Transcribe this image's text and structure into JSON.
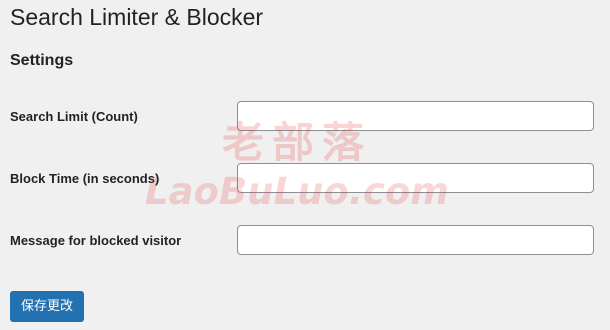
{
  "header": {
    "title": "Search Limiter & Blocker"
  },
  "settings": {
    "section_title": "Settings",
    "fields": [
      {
        "label": "Search Limit (Count)",
        "value": ""
      },
      {
        "label": "Block Time (in seconds)",
        "value": ""
      },
      {
        "label": "Message for blocked visitor",
        "value": ""
      }
    ],
    "save_label": "保存更改"
  },
  "watermark": {
    "cn_text": "老部落",
    "en_text": "LaoBuLuo.com",
    "color": "#e53935"
  },
  "colors": {
    "background": "#f0f0f1",
    "accent": "#2271b1",
    "text": "#1d2327",
    "input_border": "#8c8f94"
  }
}
